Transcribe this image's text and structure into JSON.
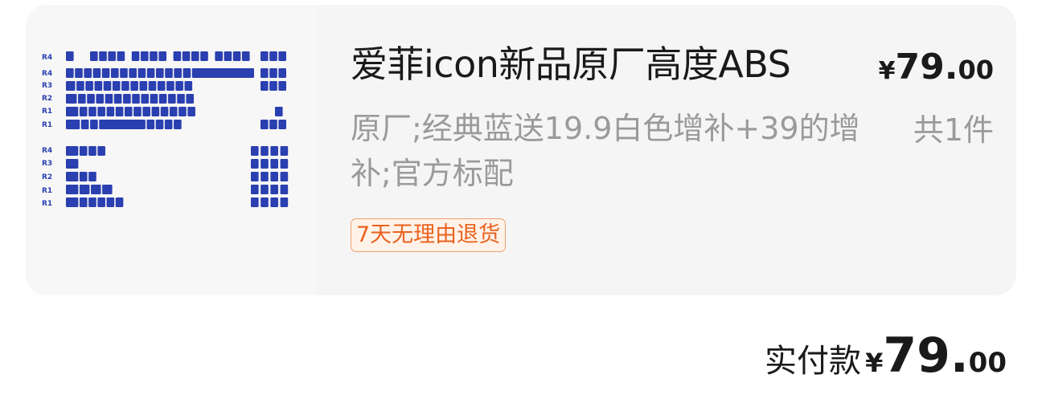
{
  "order_item": {
    "title": "爱菲icon新品原厂高度ABS",
    "price": {
      "currency": "¥",
      "integer": "79.",
      "decimal": "00"
    },
    "spec": "原厂;经典蓝送19.9白色增补+39的增补;官方标配",
    "quantity": "共1件",
    "badge": "7天无理由退货",
    "image": {
      "icon": "keycap-set-image",
      "row_labels_top": [
        "R4",
        "R4",
        "R3",
        "R2",
        "R1",
        "R1"
      ],
      "row_labels_bottom": [
        "R4",
        "R3",
        "R2",
        "R1",
        "R1"
      ],
      "keycap_color": "#2a3fb0"
    }
  },
  "summary": {
    "label": "实付款",
    "currency": "¥",
    "integer": "79.",
    "decimal": "00"
  },
  "colors": {
    "card_bg": "#f5f5f5",
    "badge_text": "#e8621e",
    "badge_border": "#f0a071",
    "muted_text": "#9a9a9a"
  }
}
